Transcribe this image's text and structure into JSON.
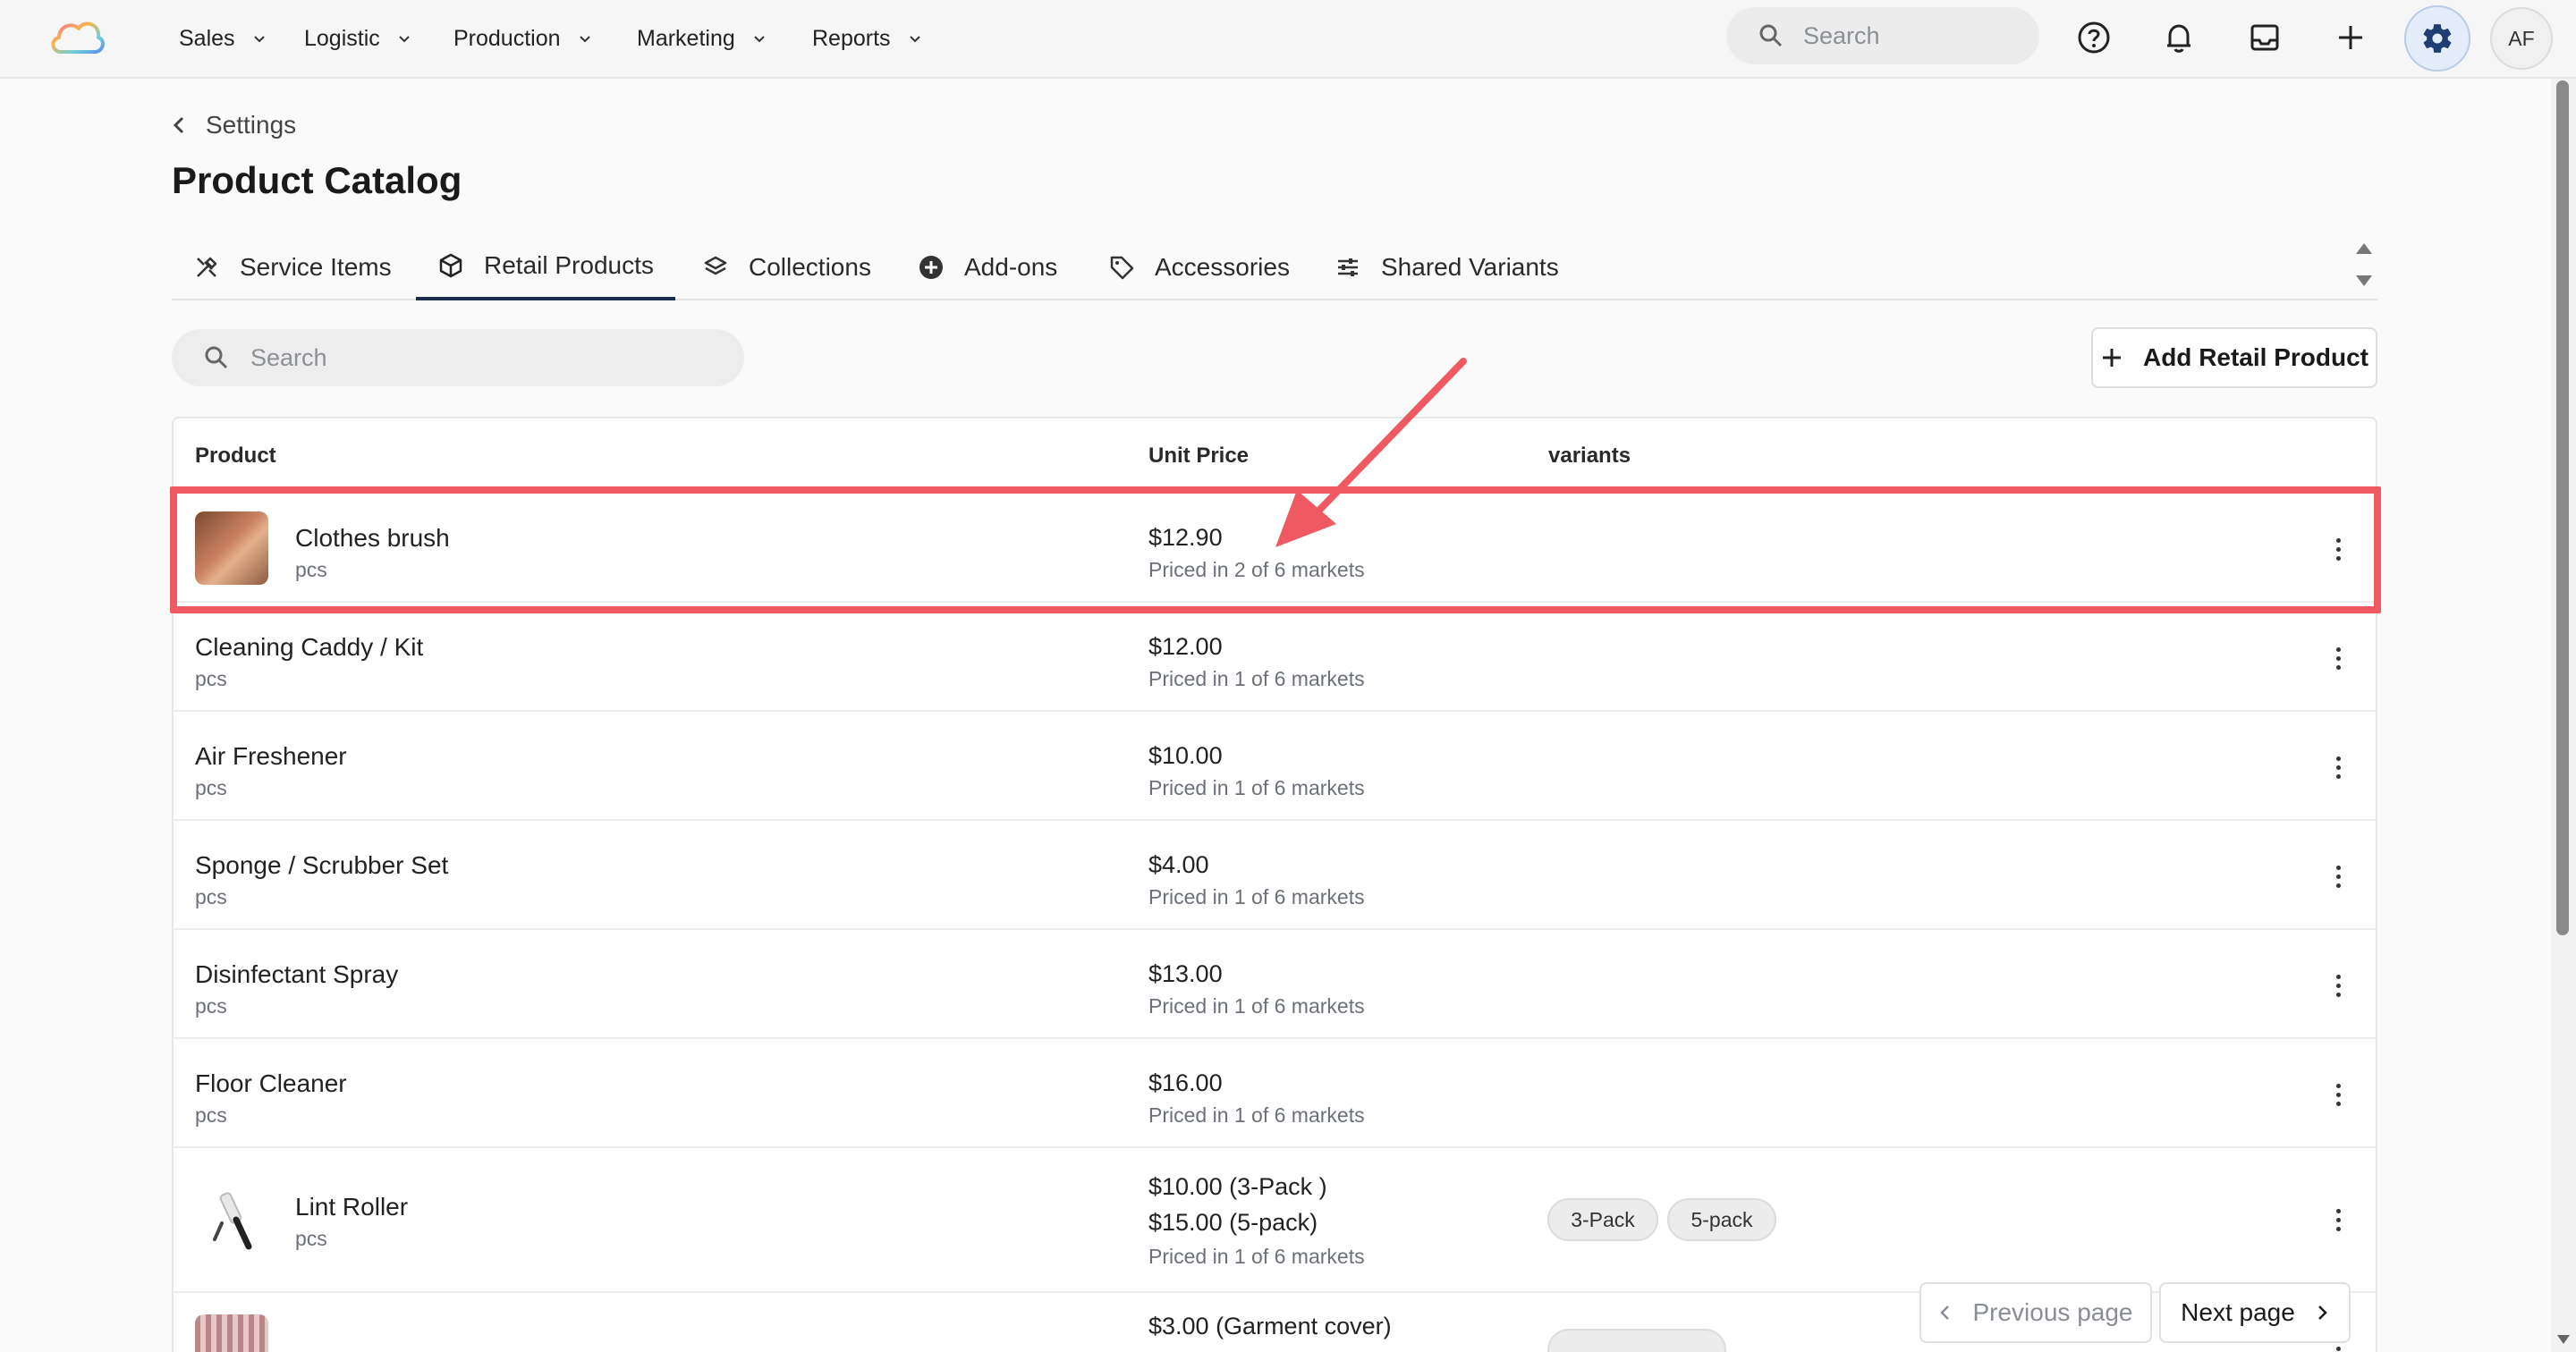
{
  "nav": {
    "items": [
      {
        "label": "Sales"
      },
      {
        "label": "Logistic"
      },
      {
        "label": "Production"
      },
      {
        "label": "Marketing"
      },
      {
        "label": "Reports"
      }
    ],
    "search_placeholder": "Search",
    "avatar_initials": "AF"
  },
  "header": {
    "back_label": "Settings",
    "title": "Product Catalog"
  },
  "tabs": [
    {
      "label": "Service Items",
      "icon": "tools-icon"
    },
    {
      "label": "Retail Products",
      "icon": "box-icon",
      "active": true
    },
    {
      "label": "Collections",
      "icon": "layers-icon"
    },
    {
      "label": "Add-ons",
      "icon": "plus-circle-icon"
    },
    {
      "label": "Accessories",
      "icon": "tag-icon"
    },
    {
      "label": "Shared Variants",
      "icon": "sliders-icon"
    }
  ],
  "toolbar": {
    "search_placeholder": "Search",
    "add_label": "Add Retail Product"
  },
  "table": {
    "columns": {
      "product": "Product",
      "unit_price": "Unit Price",
      "variants": "variants"
    },
    "rows": [
      {
        "name": "Clothes brush",
        "unit": "pcs",
        "price": "$12.90",
        "markets": "Priced in 2 of 6 markets"
      },
      {
        "name": "Cleaning Caddy / Kit",
        "unit": "pcs",
        "price": "$12.00",
        "markets": "Priced in 1 of 6 markets"
      },
      {
        "name": "Air Freshener",
        "unit": "pcs",
        "price": "$10.00",
        "markets": "Priced in 1 of 6 markets"
      },
      {
        "name": "Sponge / Scrubber Set",
        "unit": "pcs",
        "price": "$4.00",
        "markets": "Priced in 1 of 6 markets"
      },
      {
        "name": "Disinfectant Spray",
        "unit": "pcs",
        "price": "$13.00",
        "markets": "Priced in 1 of 6 markets"
      },
      {
        "name": "Floor Cleaner",
        "unit": "pcs",
        "price": "$16.00",
        "markets": "Priced in 1 of 6 markets"
      },
      {
        "name": "Lint Roller",
        "unit": "pcs",
        "price": "$10.00 (3-Pack )",
        "price2": "$15.00 (5-pack)",
        "markets": "Priced in 1 of 6 markets",
        "variants": [
          "3-Pack",
          "5-pack"
        ]
      },
      {
        "price": "$3.00 (Garment cover)"
      }
    ]
  },
  "pagination": {
    "prev_label": "Previous page",
    "next_label": "Next page"
  },
  "colors": {
    "highlight": "#ef5a62",
    "active_tab": "#1a2d4a",
    "gear_accent": "#1f3f72"
  }
}
